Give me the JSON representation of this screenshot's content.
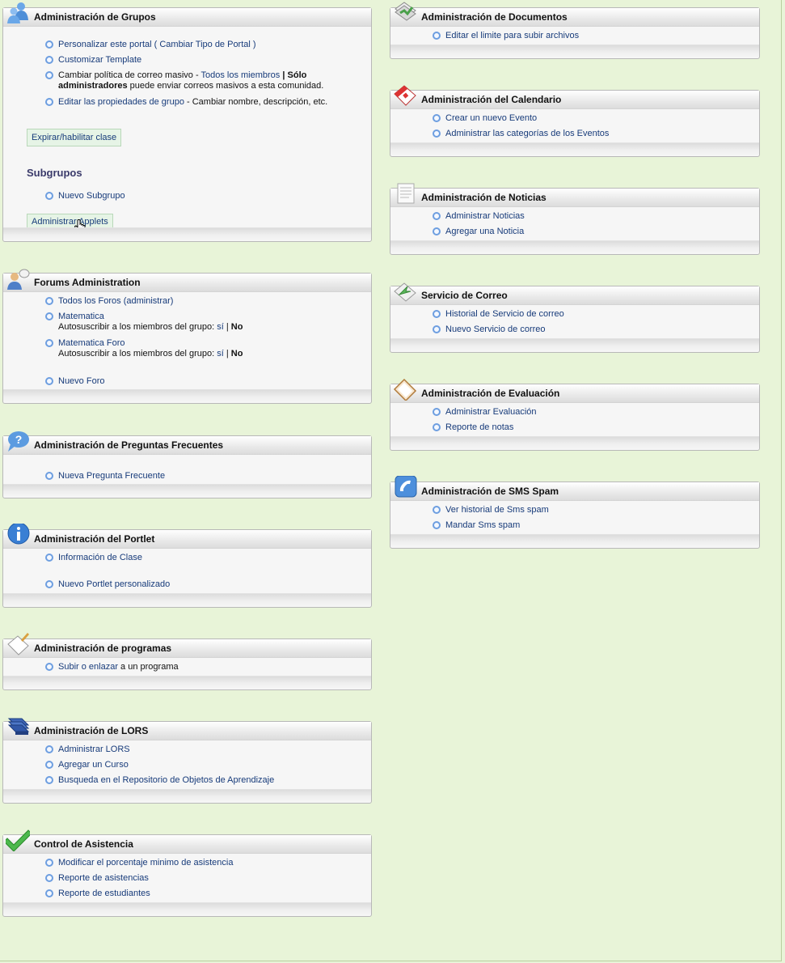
{
  "grupos": {
    "title": "Administración de Grupos",
    "personalizar": "Personalizar este portal",
    "paren_open": " ( ",
    "cambiar_tipo": "Cambiar Tipo de Portal",
    "paren_close": " )",
    "customizar": "Customizar Template",
    "correo_prefix": "Cambiar política de correo masivo - ",
    "todos_miembros": "Todos los miembros",
    "sep": " | ",
    "solo": "Sólo",
    "administradores": "administradores",
    "correo_suffix": " puede enviar correos masivos a esta comunidad.",
    "editar_props": "Editar las propiedades de grupo",
    "editar_suffix": " - Cambiar nombre, descripción, etc.",
    "expirar_btn": "Expirar/habilitar clase",
    "subgrupos_heading": "Subgrupos",
    "nuevo_subgrupo": "Nuevo Subgrupo",
    "admin_applets_btn": "Administrar Applets"
  },
  "forums": {
    "title": "Forums Administration",
    "todos_foros": "Todos los Foros",
    "paren_open": " (",
    "administrar": "administrar",
    "paren_close": ")",
    "foro1": "Matematica",
    "auto_label": "Autosuscribir a los miembros del grupo: ",
    "si": "sí",
    "sep": " | ",
    "no": "No",
    "foro2": "Matematica Foro",
    "nuevo_foro": "Nuevo Foro"
  },
  "faq": {
    "title": "Administración de Preguntas Frecuentes",
    "nueva": "Nueva Pregunta Frecuente"
  },
  "portlet": {
    "title": "Administración del Portlet",
    "info_clase": "Información de Clase",
    "nuevo_portlet": "Nuevo Portlet personalizado"
  },
  "programas": {
    "title": "Administración de programas",
    "subir": "Subir o enlazar",
    "subir_suffix": " a un programa"
  },
  "lors": {
    "title": "Administración de LORS",
    "administrar": "Administrar LORS",
    "agregar_curso": "Agregar un Curso",
    "busqueda": "Busqueda en el Repositorio de Objetos de Aprendizaje"
  },
  "asistencia": {
    "title": "Control de Asistencia",
    "modificar": "Modificar el porcentaje minimo de asistencia",
    "reporte_asist": "Reporte de asistencias",
    "reporte_est": "Reporte de estudiantes"
  },
  "documentos": {
    "title": "Administración de Documentos",
    "editar_limite": "Editar el limite para subir archivos"
  },
  "calendario": {
    "title": "Administración del Calendario",
    "crear_evento": "Crear un nuevo Evento",
    "admin_categorias": "Administrar las categorías de los Eventos"
  },
  "noticias": {
    "title": "Administración de Noticias",
    "administrar": "Administrar Noticias",
    "agregar": "Agregar una Noticia"
  },
  "correo": {
    "title": "Servicio de Correo",
    "historial": "Historial de Servicio de correo",
    "nuevo": "Nuevo Servicio de correo"
  },
  "evaluacion": {
    "title": "Administración de Evaluación",
    "administrar": "Administrar Evaluación",
    "reporte": "Reporte de notas"
  },
  "sms": {
    "title": "Administración de SMS Spam",
    "historial": "Ver historial de Sms spam",
    "mandar": "Mandar Sms spam"
  },
  "icons": {
    "grupos": "users-icon",
    "forums": "forum-users-icon",
    "faq": "question-bubble-icon",
    "portlet": "info-icon",
    "programas": "document-check-icon",
    "lors": "books-icon",
    "asistencia": "checkmark-icon",
    "documentos": "folder-icon",
    "calendario": "calendar-icon",
    "noticias": "news-icon",
    "correo": "mail-arrow-icon",
    "evaluacion": "clipboard-icon",
    "sms": "phone-icon"
  }
}
